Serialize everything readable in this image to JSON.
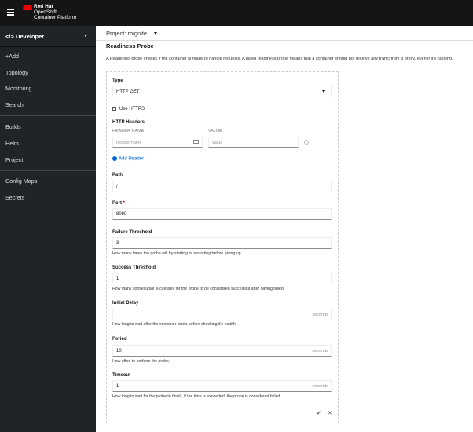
{
  "header": {
    "brand_line1": "Red Hat",
    "brand_line2": "OpenShift",
    "brand_line3": "Container Platform"
  },
  "sidebar": {
    "perspective": "Developer",
    "items": [
      "+Add",
      "Topology",
      "Monitoring",
      "Search",
      "Builds",
      "Helm",
      "Project",
      "Config Maps",
      "Secrets"
    ]
  },
  "project": "Project: rhignite",
  "page": {
    "title": "Readiness Probe",
    "description": "A Readiness probe checks if the container is ready to handle requests. A failed readiness probe means that a container should not receive any traffic from a proxy, even if it's running."
  },
  "form": {
    "type_label": "Type",
    "type_value": "HTTP GET",
    "use_https": "Use HTTPS",
    "headers_label": "HTTP Headers",
    "header_name_col": "HEADER NAME",
    "value_col": "VALUE",
    "header_name_placeholder": "header name",
    "value_placeholder": "value",
    "add_header": "Add Header",
    "path_label": "Path",
    "path_value": "/",
    "port_label": "Port",
    "port_required": "*",
    "port_value": "8080",
    "failure_label": "Failure Threshold",
    "failure_value": "3",
    "failure_help": "How many times the probe will try starting or restarting before giving up.",
    "success_label": "Success Threshold",
    "success_value": "1",
    "success_help": "How many consecutive successes for the probe to be considered successful after having failed.",
    "delay_label": "Initial Delay",
    "delay_value": "",
    "delay_help": "How long to wait after the container starts before checking it's health.",
    "period_label": "Period",
    "period_value": "10",
    "period_help": "How often to perform the probe.",
    "timeout_label": "Timeout",
    "timeout_value": "1",
    "timeout_help": "How long to wait for the probe to finish, if the time is exceeded, the probe is considered failed.",
    "unit": "seconds",
    "confirm": "✔",
    "cancel": "✕"
  }
}
